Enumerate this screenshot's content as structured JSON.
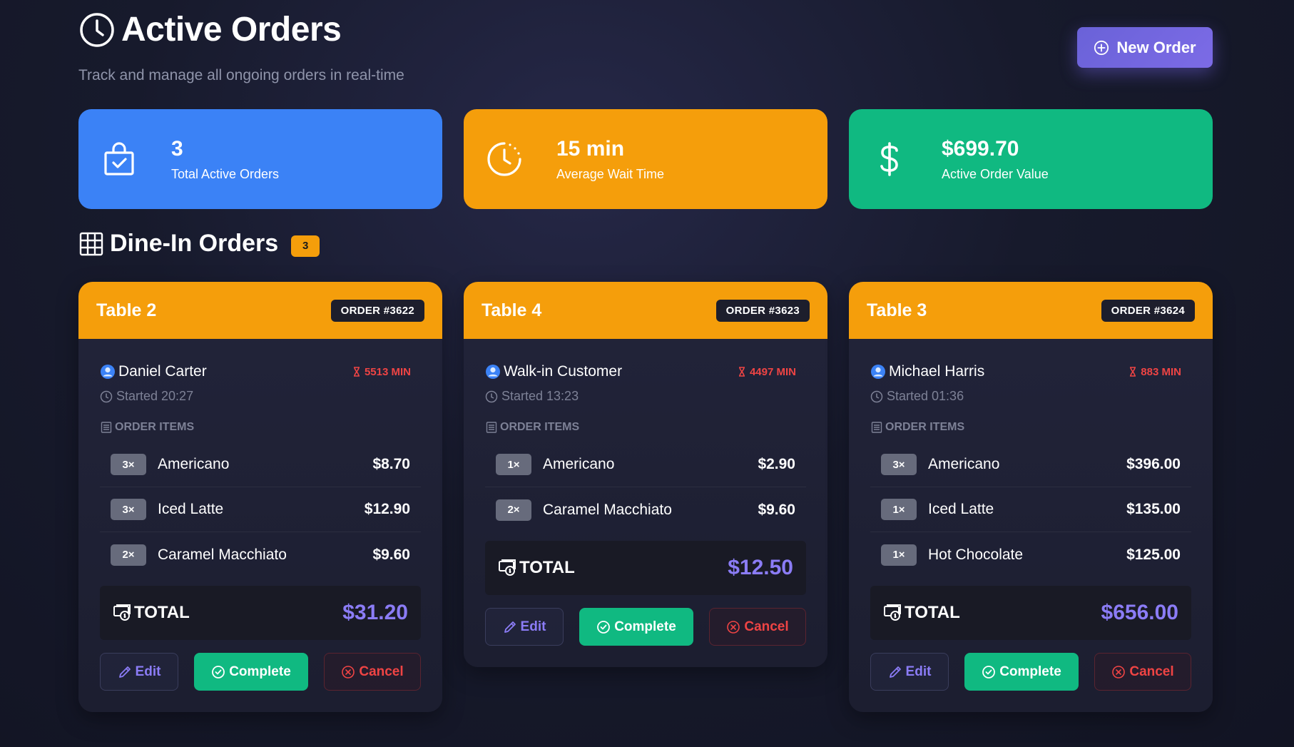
{
  "header": {
    "title": "Active Orders",
    "subtitle": "Track and manage all ongoing orders in real-time",
    "new_order_label": "New Order"
  },
  "stats": [
    {
      "value": "3",
      "label": "Total Active Orders",
      "icon": "shopping-bag-check-icon",
      "color": "#3b82f6"
    },
    {
      "value": "15 min",
      "label": "Average Wait Time",
      "icon": "clock-icon",
      "color": "#f59e0b"
    },
    {
      "value": "$699.70",
      "label": "Active Order Value",
      "icon": "dollar-icon",
      "color": "#10b981"
    }
  ],
  "section": {
    "title": "Dine-In Orders",
    "count": "3"
  },
  "labels": {
    "order_items": "ORDER ITEMS",
    "total": "TOTAL",
    "edit": "Edit",
    "complete": "Complete",
    "cancel": "Cancel"
  },
  "orders": [
    {
      "table": "Table 2",
      "order_no": "ORDER #3622",
      "customer": "Daniel Carter",
      "wait": "5513 MIN",
      "started": "Started 20:27",
      "items": [
        {
          "qty": "3×",
          "name": "Americano",
          "price": "$8.70"
        },
        {
          "qty": "3×",
          "name": "Iced Latte",
          "price": "$12.90"
        },
        {
          "qty": "2×",
          "name": "Caramel Macchiato",
          "price": "$9.60"
        }
      ],
      "total": "$31.20"
    },
    {
      "table": "Table 4",
      "order_no": "ORDER #3623",
      "customer": "Walk-in Customer",
      "wait": "4497 MIN",
      "started": "Started 13:23",
      "items": [
        {
          "qty": "1×",
          "name": "Americano",
          "price": "$2.90"
        },
        {
          "qty": "2×",
          "name": "Caramel Macchiato",
          "price": "$9.60"
        }
      ],
      "total": "$12.50"
    },
    {
      "table": "Table 3",
      "order_no": "ORDER #3624",
      "customer": "Michael Harris",
      "wait": "883 MIN",
      "started": "Started 01:36",
      "items": [
        {
          "qty": "3×",
          "name": "Americano",
          "price": "$396.00"
        },
        {
          "qty": "1×",
          "name": "Iced Latte",
          "price": "$135.00"
        },
        {
          "qty": "1×",
          "name": "Hot Chocolate",
          "price": "$125.00"
        }
      ],
      "total": "$656.00"
    }
  ],
  "colors": {
    "accent": "#8b7cf6",
    "warning": "#f59e0b",
    "success": "#10b981",
    "danger": "#ef4444",
    "info": "#3b82f6"
  }
}
